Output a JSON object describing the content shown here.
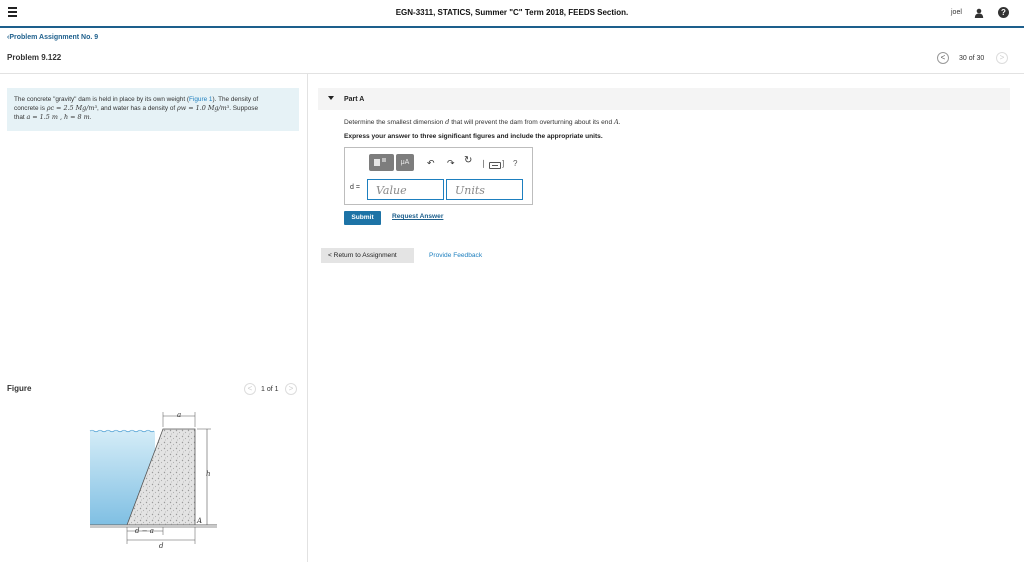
{
  "header": {
    "course_title": "EGN-3311, STATICS, Summer \"C\" Term 2018, FEEDS Section.",
    "user_name": "joel",
    "help_label": "?"
  },
  "nav": {
    "back_link": "Problem Assignment No. 9",
    "problem_title": "Problem 9.122",
    "position": "30 of 30",
    "prev_glyph": "<",
    "next_glyph": ">"
  },
  "problem": {
    "line1_text": "The concrete \"gravity\" dam is held in place by its own weight (",
    "figure_link": "Figure 1",
    "line1_end": "). The density of",
    "line2_a": "concrete is ",
    "line2_rho_c": "ρc = 2.5 Mg/m³",
    "line2_b": ", and water has a density of ",
    "line2_rho_w": "ρw = 1.0 Mg/m³",
    "line2_c": ". Suppose",
    "line3_a": "that ",
    "line3_values": "a = 1.5 m , h = 8 m",
    "line3_end": "."
  },
  "figure": {
    "label": "Figure",
    "position": "1 of 1",
    "labels": {
      "a_top": "a",
      "h": "h",
      "A": "A",
      "d_minus_a": "d − a",
      "d": "d"
    },
    "colors": {
      "water": "#8cc6e6",
      "water_light": "#d4ecf7",
      "concrete": "#e3e3e3",
      "ground": "#c9c9c9"
    }
  },
  "part": {
    "title": "Part A",
    "question_a": "Determine the smallest dimension ",
    "question_var": "d",
    "question_b": " that will prevent the dam from overturning about its end ",
    "question_end_var": "A",
    "question_end": ".",
    "instructions": "Express your answer to three significant figures and include the appropriate units."
  },
  "toolbar": {
    "templates_icon": "templates-icon",
    "units_button": "μA",
    "undo_icon": "↶",
    "redo_icon": "↷",
    "reset_icon": "↻",
    "separator": "❘",
    "keyboard_bracket": "]",
    "help_icon": "?"
  },
  "answer": {
    "variable_label": "d =",
    "value_placeholder": "Value",
    "units_placeholder": "Units"
  },
  "actions": {
    "submit": "Submit",
    "request_answer": "Request Answer",
    "return_to_assignment": "< Return to Assignment",
    "provide_feedback": "Provide Feedback"
  },
  "colors": {
    "accent": "#1d5f8c",
    "link": "#1d7fbf",
    "submit": "#1d73a6",
    "problem_bg": "#e6f2f6"
  }
}
